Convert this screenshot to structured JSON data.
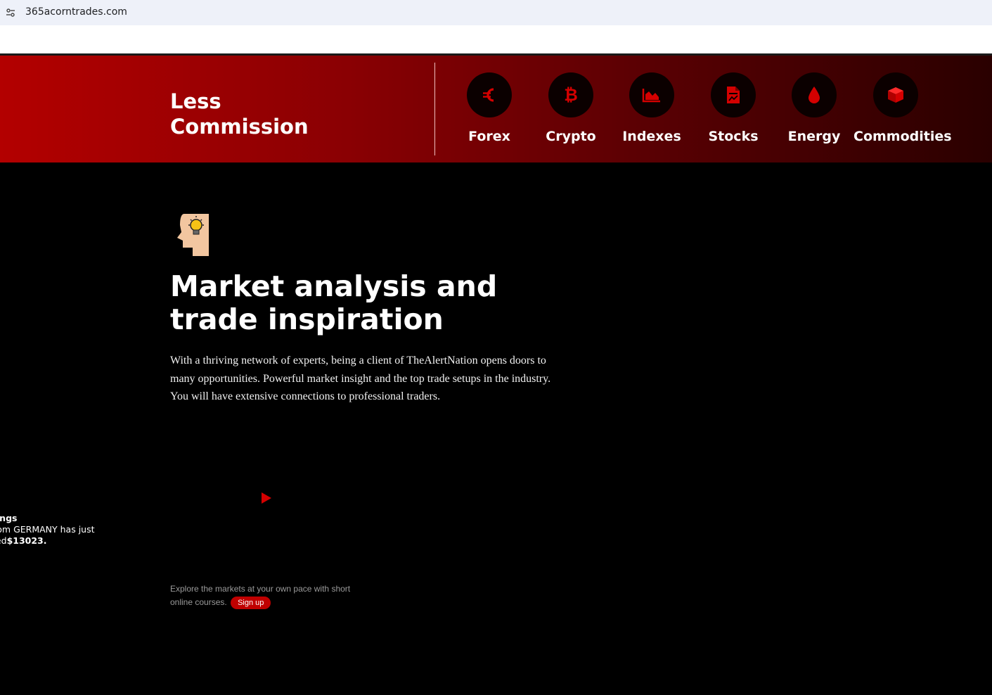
{
  "browser": {
    "url": "365acorntrades.com"
  },
  "banner": {
    "headline_line1": "Less",
    "headline_line2": "Commission",
    "markets": [
      {
        "label": "Forex",
        "icon": "euro-icon"
      },
      {
        "label": "Crypto",
        "icon": "bitcoin-icon"
      },
      {
        "label": "Indexes",
        "icon": "area-chart-icon"
      },
      {
        "label": "Stocks",
        "icon": "document-chart-icon"
      },
      {
        "label": "Energy",
        "icon": "drop-icon"
      },
      {
        "label": "Commodities",
        "icon": "cube-icon"
      }
    ]
  },
  "main": {
    "title_line1": "Market analysis and",
    "title_line2": "trade inspiration",
    "description": "With a thriving network of experts, being a client of TheAlertNation opens doors to many opportunities. Powerful market insight and the top trade setups in the industry. You will have extensive connections to professional traders.",
    "explore_text": "Explore the markets at your own pace with short online courses.",
    "signup_label": "Sign up"
  },
  "notice": {
    "line1": "nings",
    "line2": "from GERMANY has just",
    "line3_prefix": "ned",
    "amount": "$13023."
  },
  "colors": {
    "accent": "#c00000",
    "banner_start": "#b30000",
    "banner_end": "#2a0000",
    "icon_circle": "#0b0000"
  }
}
